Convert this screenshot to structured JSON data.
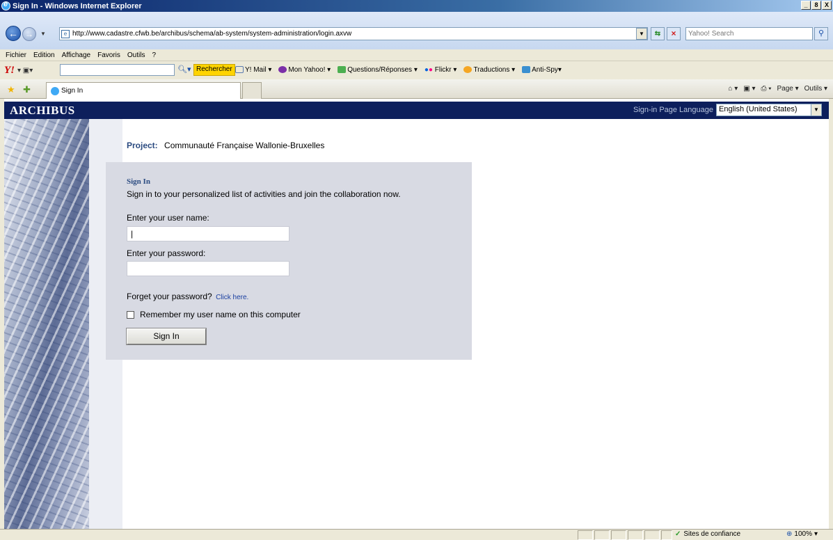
{
  "window": {
    "title": "Sign In - Windows Internet Explorer",
    "min": "_",
    "max": "8",
    "close": "X"
  },
  "address": {
    "url": "http://www.cadastre.cfwb.be/archibus/schema/ab-system/system-administration/login.axvw",
    "search_placeholder": "Yahoo! Search"
  },
  "menu": [
    "Fichier",
    "Edition",
    "Affichage",
    "Favoris",
    "Outils",
    "?"
  ],
  "yahoo": {
    "logo": "Y!",
    "rechercher": "Rechercher",
    "items": [
      {
        "label": "Y! Mail",
        "color": "#ffffff"
      },
      {
        "label": "Mon Yahoo!",
        "color": "#7b2fa8"
      },
      {
        "label": "Questions/Réponses",
        "color": "#4caf50"
      },
      {
        "label": "Flickr",
        "color": "#ff0084"
      },
      {
        "label": "Traductions",
        "color": "#f5a623"
      },
      {
        "label": "Anti-Spy",
        "color": "#3a8fd0"
      }
    ]
  },
  "tab": {
    "label": "Sign In"
  },
  "commands": [
    "Page ▾",
    "Outils ▾"
  ],
  "archibus": {
    "logo": "ARCHIBUS",
    "lang_label": "Sign-in Page Language",
    "lang_value": "English (United States)"
  },
  "project": {
    "label": "Project:",
    "name": "Communauté Française Wallonie-Bruxelles"
  },
  "signin": {
    "title": "Sign In",
    "description": "Sign in to your personalized list of activities and join the collaboration now.",
    "username_label": "Enter your user name:",
    "username_value": "|",
    "password_label": "Enter your password:",
    "password_value": "",
    "forgot_text": "Forget your password?",
    "forgot_link": "Click here.",
    "remember_label": "Remember my user name on this computer",
    "button": "Sign In"
  },
  "status": {
    "zone": "Sites de confiance",
    "zoom": "100%"
  }
}
